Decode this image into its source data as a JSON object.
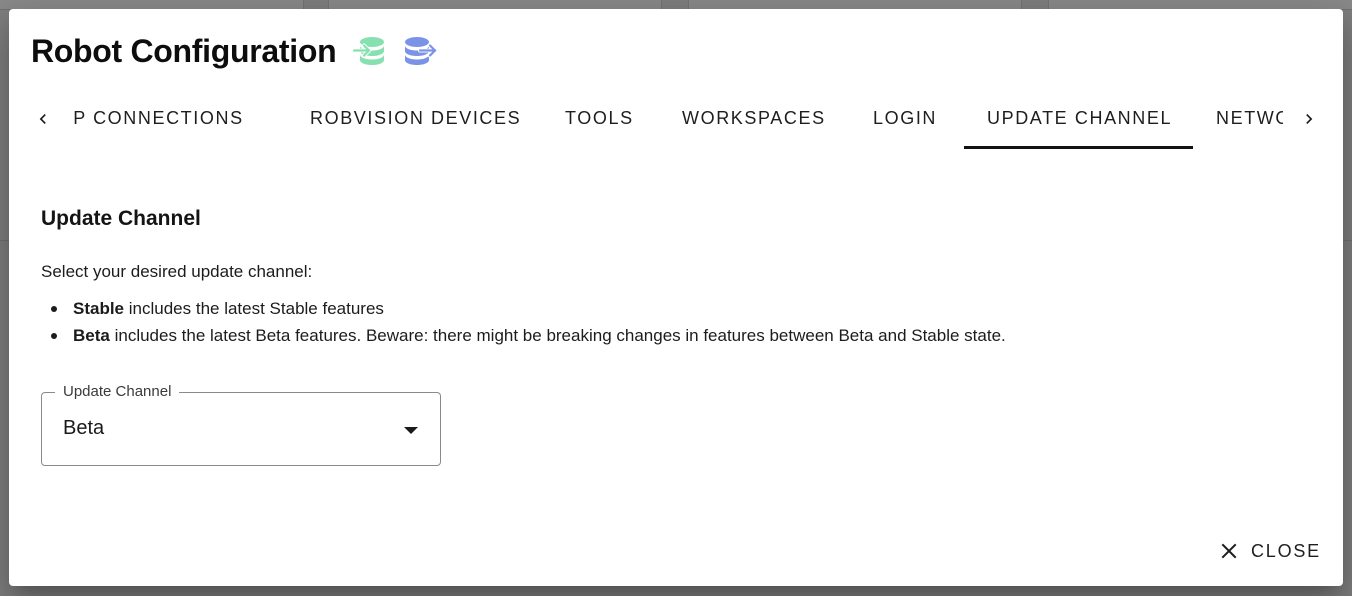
{
  "dialog": {
    "title": "Robot Configuration",
    "header_icons": [
      "database-import-icon",
      "database-export-icon"
    ],
    "colors": {
      "import_icon": "#86e0b0",
      "export_icon": "#7b93e6"
    }
  },
  "tabs": {
    "items": [
      {
        "label": "TCP CONNECTIONS",
        "active": false
      },
      {
        "label": "ROBVISION DEVICES",
        "active": false
      },
      {
        "label": "TOOLS",
        "active": false
      },
      {
        "label": "WORKSPACES",
        "active": false
      },
      {
        "label": "LOGIN",
        "active": false
      },
      {
        "label": "UPDATE CHANNEL",
        "active": true
      },
      {
        "label": "NETWORK",
        "active": false
      }
    ],
    "scroll_left_icon": "chevron-left-icon",
    "scroll_right_icon": "chevron-right-icon"
  },
  "update_channel": {
    "title": "Update Channel",
    "description": "Select your desired update channel:",
    "options_info": [
      {
        "name": "Stable",
        "text": " includes the latest Stable features"
      },
      {
        "name": "Beta",
        "text": " includes the latest Beta features. Beware: there might be breaking changes in features between Beta and Stable state."
      }
    ],
    "select": {
      "label": "Update Channel",
      "value": "Beta",
      "icon": "caret-down-icon"
    }
  },
  "footer": {
    "close_label": "CLOSE",
    "close_icon": "close-icon"
  }
}
